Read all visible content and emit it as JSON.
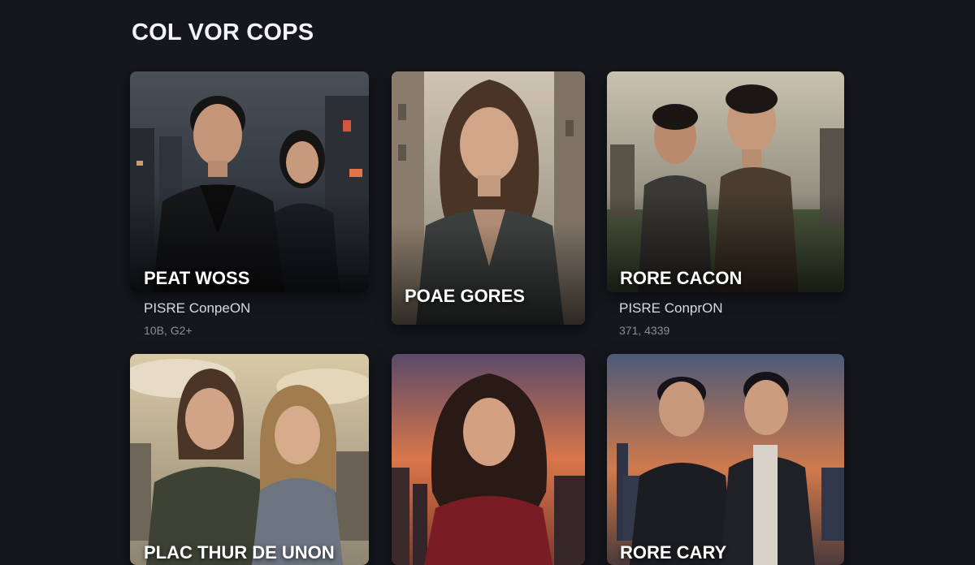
{
  "header": {
    "title": "COL VOR COPS"
  },
  "cards": [
    {
      "title": "PEAT WOSS",
      "meta": "PISRE ConpeON",
      "count": "10B, G2+"
    },
    {
      "title": "POAE GORES"
    },
    {
      "title": "RORE CACON",
      "meta": "PISRE ConprON",
      "count": "371, 4339"
    },
    {
      "title": "PLAC THUR DE UNON"
    },
    {
      "title": ""
    },
    {
      "title": "RORE CARY"
    }
  ],
  "colors": {
    "background": "#15171d",
    "title_text": "#f4f4f6",
    "meta_text": "#d8dade",
    "count_text": "#8b8e96"
  }
}
